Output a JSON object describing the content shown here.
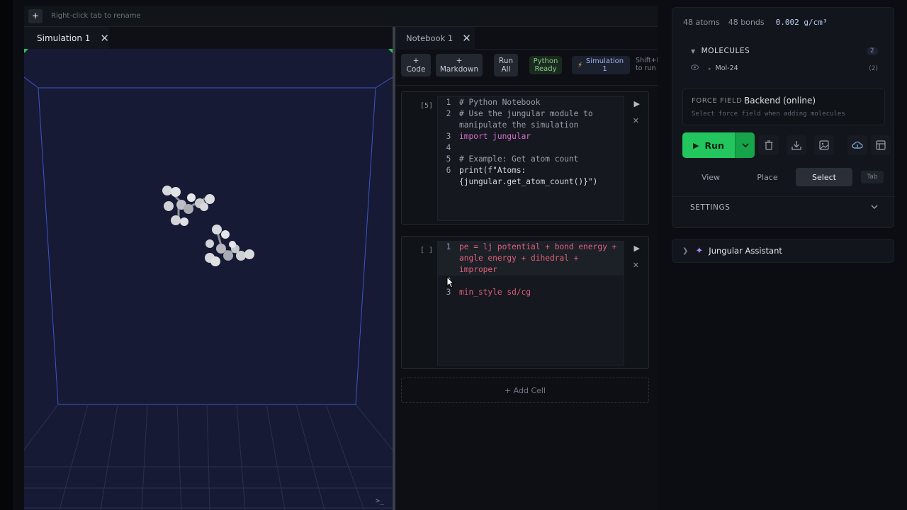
{
  "workspace": {
    "add_label": "+",
    "hint": "Right-click tab to rename"
  },
  "simulation": {
    "tab_label": "Simulation 1",
    "terminal_glyph": ">_"
  },
  "notebook": {
    "tab_label": "Notebook 1",
    "toolbar": {
      "add_code": [
        "+",
        "Code"
      ],
      "add_markdown": [
        "+",
        "Markdown"
      ],
      "run_all": [
        "Run",
        "All"
      ],
      "python_status": [
        "Python",
        "Ready"
      ],
      "sim_link": "Simulation 1",
      "shortcut_hint": [
        "Shift+E",
        "to run"
      ]
    },
    "cells": [
      {
        "count": "[5]",
        "lines": [
          {
            "n": "1",
            "parts": [
              {
                "t": "# Python Notebook",
                "c": "comment"
              }
            ]
          },
          {
            "n": "2",
            "parts": [
              {
                "t": "# Use the jungular module to manipulate the simulation",
                "c": "comment"
              }
            ]
          },
          {
            "n": "3",
            "parts": [
              {
                "t": "import",
                "c": "kw"
              },
              {
                "t": " jungular",
                "c": "kw"
              }
            ]
          },
          {
            "n": "4",
            "parts": [
              {
                "t": "",
                "c": ""
              }
            ]
          },
          {
            "n": "5",
            "parts": [
              {
                "t": "# Example: Get atom count",
                "c": "comment"
              }
            ]
          },
          {
            "n": "6",
            "parts": [
              {
                "t": "print(f\"Atoms: {jungular.get_atom_count()}\")",
                "c": "fn"
              }
            ]
          }
        ]
      },
      {
        "count": "[ ]",
        "lines": [
          {
            "n": "1",
            "parts": [
              {
                "t": "pe = lj potential + bond energy + angle energy + dihedral + improper",
                "c": "red"
              }
            ],
            "hl": true
          },
          {
            "n": "2",
            "parts": [
              {
                "t": "",
                "c": ""
              }
            ]
          },
          {
            "n": "3",
            "parts": [
              {
                "t": "min_style sd/cg",
                "c": "red"
              }
            ]
          }
        ]
      }
    ],
    "add_cell_label": "+ Add Cell"
  },
  "panel": {
    "stats": {
      "atoms": "48 atoms",
      "bonds": "48 bonds",
      "density": "0.002 g/cm³"
    },
    "molecules": {
      "title": "MOLECULES",
      "count": "2",
      "items": [
        {
          "name": "Mol-24",
          "count": "(2)"
        }
      ]
    },
    "force_field": {
      "label": "FORCE FIELD",
      "value": "Backend (online)",
      "hint": "Select force field when adding molecules"
    },
    "run_label": "Run",
    "modes": [
      "View",
      "Place",
      "Select"
    ],
    "active_mode": "Select",
    "tab_key": "Tab",
    "settings_label": "SETTINGS",
    "assistant_label": "Jungular Assistant"
  },
  "colors": {
    "accent_green": "#22c55e",
    "viewport_bg": "#171a35",
    "keyword": "#d46fd0",
    "error_text": "#e0607a"
  }
}
